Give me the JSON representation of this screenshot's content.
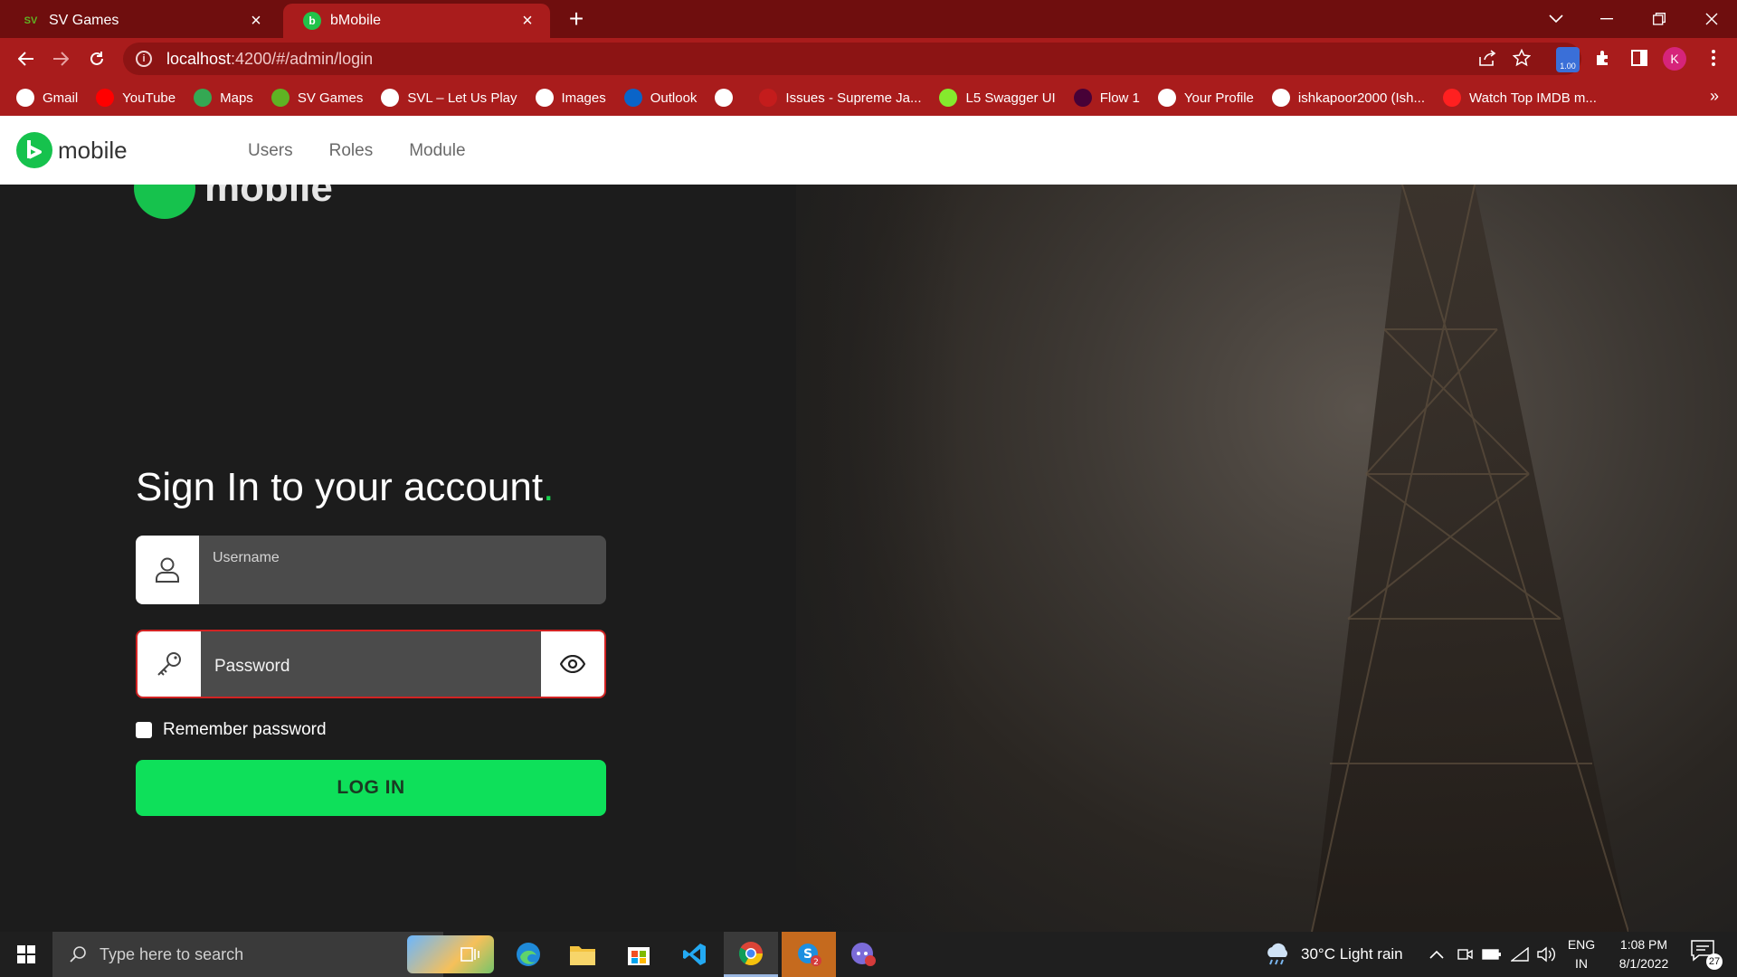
{
  "browser": {
    "tabs": [
      {
        "title": "SV Games",
        "favicon": "SV",
        "active": false
      },
      {
        "title": "bMobile",
        "favicon": "b",
        "active": true
      }
    ],
    "new_tab": "+",
    "url_host": "localhost",
    "url_path": ":4200/#/admin/login",
    "extension_badge": "1.00",
    "profile_initial": "K",
    "bookmarks": [
      {
        "label": "Gmail",
        "icon": "gmail-icon",
        "color": "#ffffff"
      },
      {
        "label": "YouTube",
        "icon": "youtube-icon",
        "color": "#ff0000"
      },
      {
        "label": "Maps",
        "icon": "maps-icon",
        "color": "#34a853"
      },
      {
        "label": "SV Games",
        "icon": "sv-icon",
        "color": "#5fb323"
      },
      {
        "label": "SVL – Let Us Play",
        "icon": "globe-icon",
        "color": "#ffffff"
      },
      {
        "label": "Images",
        "icon": "globe-icon",
        "color": "#ffffff"
      },
      {
        "label": "Outlook",
        "icon": "outlook-icon",
        "color": "#0a64c8"
      },
      {
        "label": "",
        "icon": "globe-icon",
        "color": "#ffffff"
      },
      {
        "label": "Issues - Supreme Ja...",
        "icon": "jira-icon",
        "color": "#c41c1c"
      },
      {
        "label": "L5 Swagger UI",
        "icon": "swagger-icon",
        "color": "#85ea2d"
      },
      {
        "label": "Flow 1",
        "icon": "xd-icon",
        "color": "#470137"
      },
      {
        "label": "Your Profile",
        "icon": "github-icon",
        "color": "#ffffff"
      },
      {
        "label": "ishkapoor2000 (Ish...",
        "icon": "github-icon",
        "color": "#ffffff"
      },
      {
        "label": "Watch Top IMDB m...",
        "icon": "play-icon",
        "color": "#ff2020"
      }
    ],
    "bookmarks_more": "»"
  },
  "app": {
    "logo_text": "mobile",
    "nav": [
      "Users",
      "Roles",
      "Module"
    ]
  },
  "login": {
    "ghost_logo_text": "mobile",
    "title": "Sign In to your account",
    "title_dot": ".",
    "username_placeholder": "Username",
    "password_placeholder": "Password",
    "remember_label": "Remember password",
    "login_button": "LOG IN",
    "accent_color": "#0ee05a",
    "error_border_color": "#d22323"
  },
  "taskbar": {
    "search_placeholder": "Type here to search",
    "weather": "30°C  Light rain",
    "lang_top": "ENG",
    "lang_bottom": "IN",
    "time": "1:08 PM",
    "date": "8/1/2022",
    "notification_count": "27",
    "extension_count": "2"
  }
}
